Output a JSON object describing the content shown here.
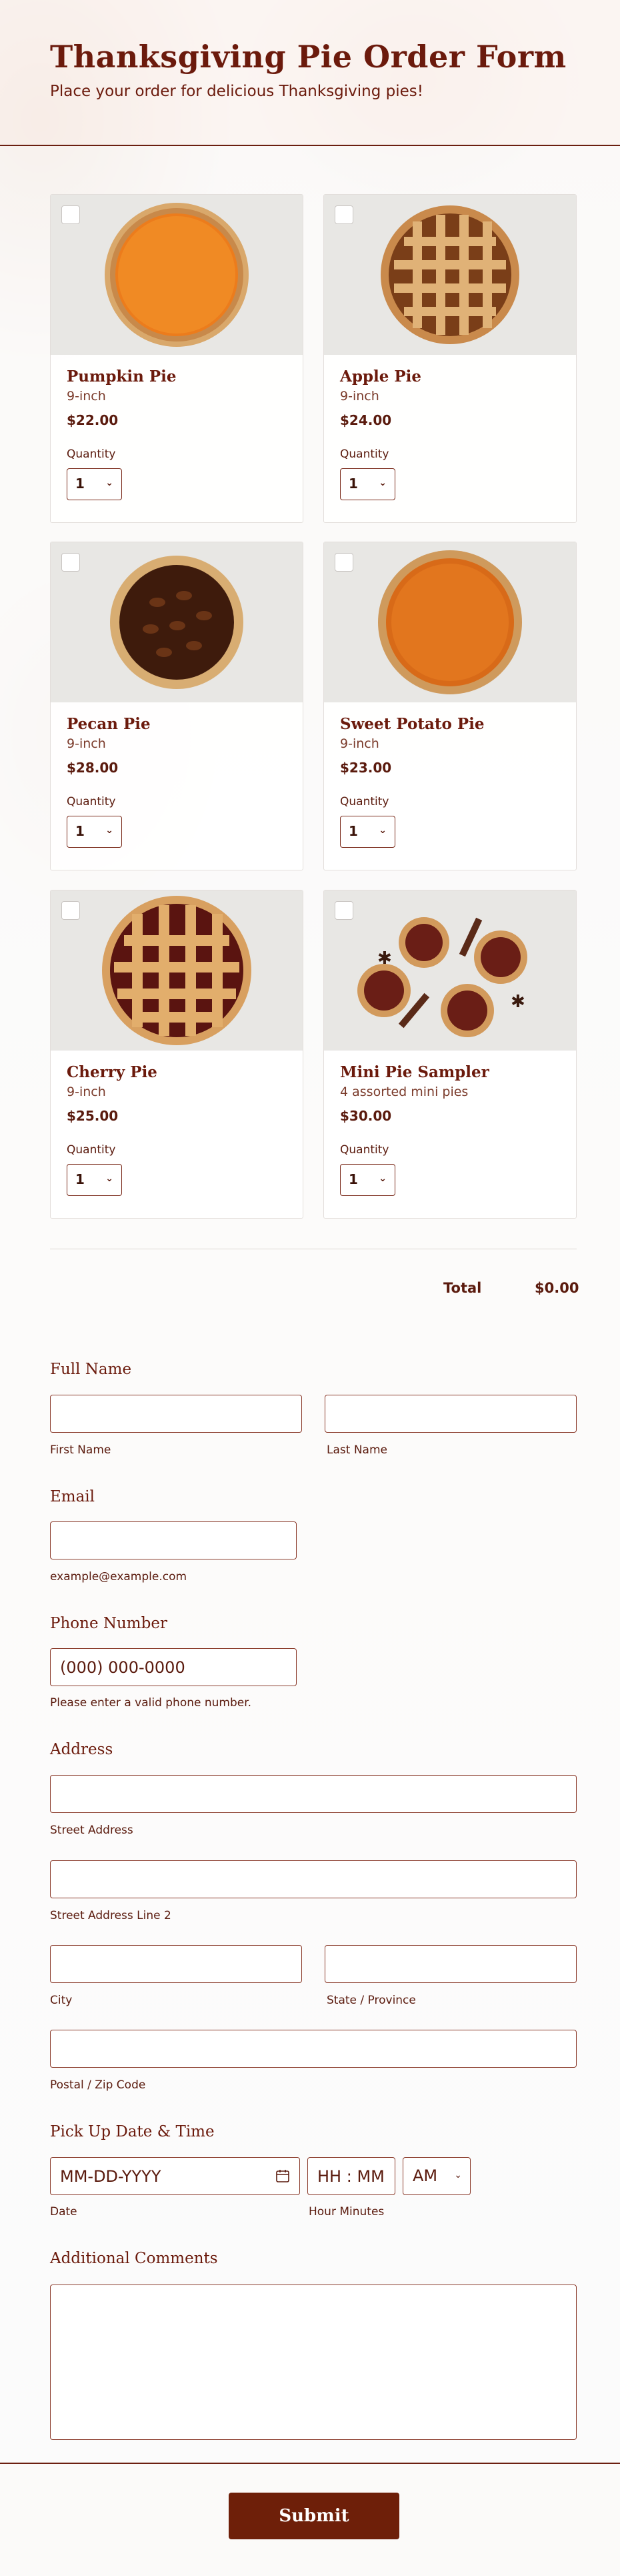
{
  "header": {
    "title": "Thanksgiving Pie Order Form",
    "subtitle": "Place your order for delicious Thanksgiving pies!"
  },
  "products": [
    {
      "name": "Pumpkin Pie",
      "desc": "9-inch",
      "price": "$22.00",
      "qty_label": "Quantity",
      "qty": "1"
    },
    {
      "name": "Apple Pie",
      "desc": "9-inch",
      "price": "$24.00",
      "qty_label": "Quantity",
      "qty": "1"
    },
    {
      "name": "Pecan Pie",
      "desc": "9-inch",
      "price": "$28.00",
      "qty_label": "Quantity",
      "qty": "1"
    },
    {
      "name": "Sweet Potato Pie",
      "desc": "9-inch",
      "price": "$23.00",
      "qty_label": "Quantity",
      "qty": "1"
    },
    {
      "name": "Cherry Pie",
      "desc": "9-inch",
      "price": "$25.00",
      "qty_label": "Quantity",
      "qty": "1"
    },
    {
      "name": "Mini Pie Sampler",
      "desc": "4 assorted mini pies",
      "price": "$30.00",
      "qty_label": "Quantity",
      "qty": "1"
    }
  ],
  "total": {
    "label": "Total",
    "value": "$0.00"
  },
  "full_name": {
    "label": "Full Name",
    "first": "First Name",
    "last": "Last Name"
  },
  "email": {
    "label": "Email",
    "sublabel": "example@example.com"
  },
  "phone": {
    "label": "Phone Number",
    "placeholder": "(000) 000-0000",
    "sublabel": "Please enter a valid phone number."
  },
  "address": {
    "label": "Address",
    "street": "Street Address",
    "street2": "Street Address Line 2",
    "city": "City",
    "state": "State / Province",
    "zip": "Postal / Zip Code"
  },
  "pickup": {
    "label": "Pick Up Date & Time",
    "date_placeholder": "MM-DD-YYYY",
    "date_sub": "Date",
    "time_placeholder": "HH : MM",
    "time_sub": "Hour Minutes",
    "ampm": "AM"
  },
  "comments": {
    "label": "Additional Comments"
  },
  "submit_label": "Submit",
  "colors": {
    "accent": "#6e1f09",
    "text": "#5a1a0d",
    "border": "#8a3a2a"
  }
}
